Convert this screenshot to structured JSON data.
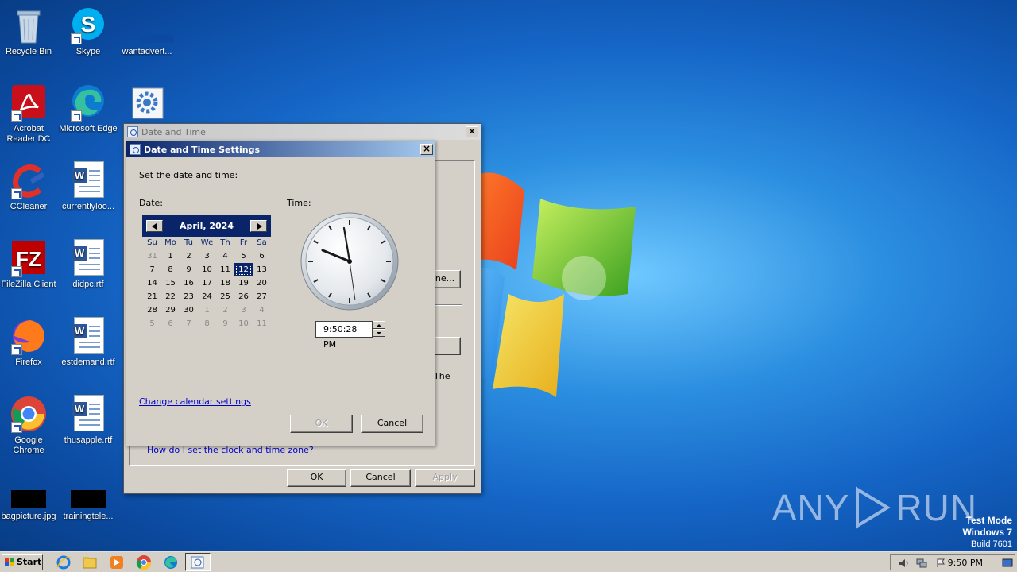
{
  "desktop": {
    "icons": [
      {
        "label": "Recycle Bin"
      },
      {
        "label": "Skype"
      },
      {
        "label": "wantadvert..."
      },
      {
        "label": "Acrobat Reader DC"
      },
      {
        "label": "Microsoft Edge"
      },
      {
        "label": "CCleaner"
      },
      {
        "label": "currentlyloo..."
      },
      {
        "label": "FileZilla Client"
      },
      {
        "label": "didpc.rtf"
      },
      {
        "label": "Firefox"
      },
      {
        "label": "estdemand.rtf"
      },
      {
        "label": "Google Chrome"
      },
      {
        "label": "thusapple.rtf"
      },
      {
        "label": "bagpicture.jpg"
      },
      {
        "label": "trainingtele..."
      }
    ],
    "watermark": {
      "left": "ANY",
      "right": "RUN"
    },
    "test_mode": {
      "line1": "Test Mode",
      "line2": "Windows 7",
      "line3": "Build 7601"
    }
  },
  "outer_window": {
    "title": "Date and Time",
    "partial_button": "ne...",
    "partial_text": "The",
    "link": "How do I set the clock and time zone?",
    "ok": "OK",
    "cancel": "Cancel",
    "apply": "Apply"
  },
  "dialog": {
    "title": "Date and Time Settings",
    "instruction": "Set the date and time:",
    "date_label": "Date:",
    "time_label": "Time:",
    "calendar": {
      "month_year": "April, 2024",
      "dow": [
        "Su",
        "Mo",
        "Tu",
        "We",
        "Th",
        "Fr",
        "Sa"
      ],
      "days": [
        "31",
        "1",
        "2",
        "3",
        "4",
        "5",
        "6",
        "7",
        "8",
        "9",
        "10",
        "11",
        "12",
        "13",
        "14",
        "15",
        "16",
        "17",
        "18",
        "19",
        "20",
        "21",
        "22",
        "23",
        "24",
        "25",
        "26",
        "27",
        "28",
        "29",
        "30",
        "1",
        "2",
        "3",
        "4",
        "5",
        "6",
        "7",
        "8",
        "9",
        "10",
        "11"
      ],
      "selected": "12"
    },
    "time_value": "9:50:28 PM",
    "change_calendar_link": "Change calendar settings",
    "ok": "OK",
    "cancel": "Cancel"
  },
  "taskbar": {
    "start_label": "Start",
    "clock": "9:50 PM"
  }
}
